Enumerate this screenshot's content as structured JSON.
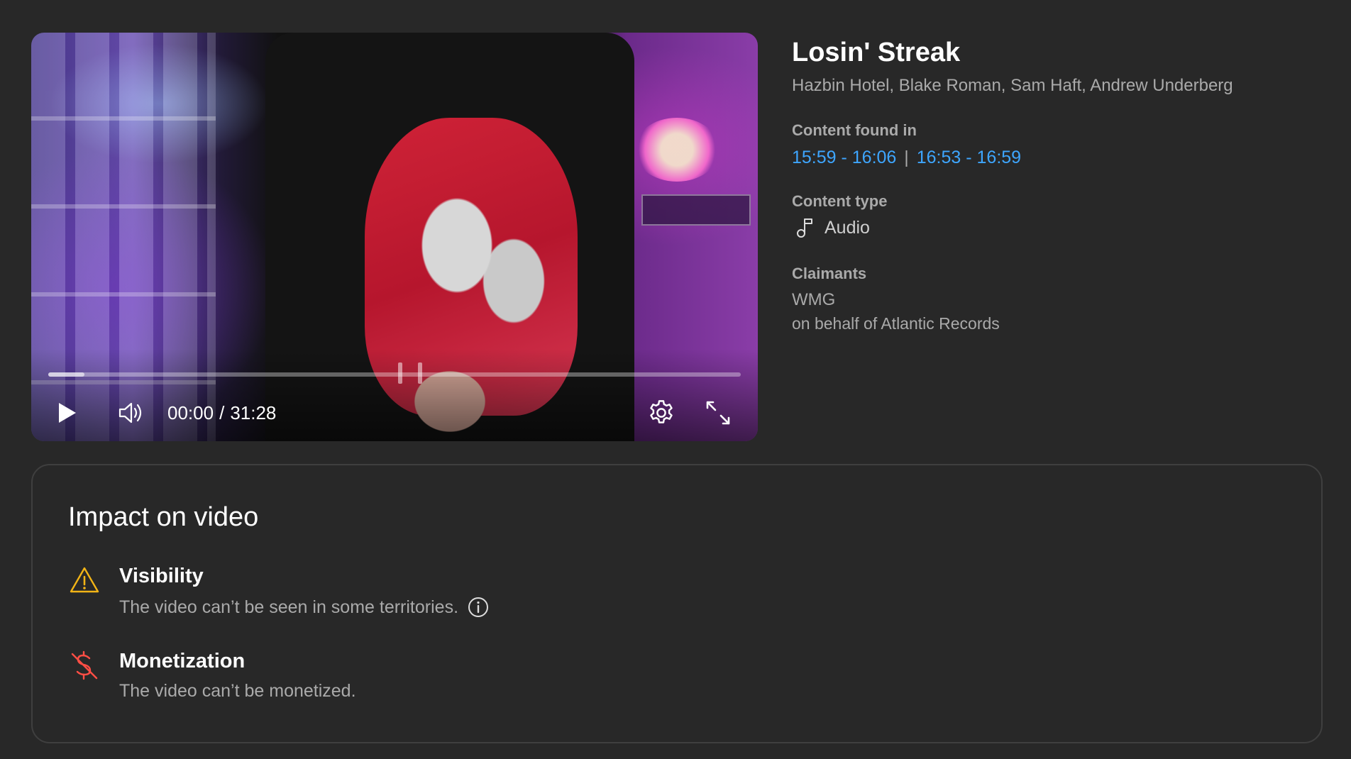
{
  "player": {
    "current_time": "00:00",
    "separator": "/",
    "duration": "31:28",
    "progress_fraction": 0.0,
    "buffered_fraction": 0.052,
    "claim_markers_fraction": [
      0.508,
      0.537
    ]
  },
  "track": {
    "title": "Losin' Streak",
    "artists": "Hazbin Hotel, Blake Roman, Sam Haft, Andrew Underberg"
  },
  "content_found": {
    "label": "Content found in",
    "ranges": [
      "15:59 - 16:06",
      "16:53 - 16:59"
    ],
    "separator": "|"
  },
  "content_type": {
    "label": "Content type",
    "value": "Audio",
    "icon": "music-note-icon"
  },
  "claimants": {
    "label": "Claimants",
    "name": "WMG",
    "on_behalf": "on behalf of Atlantic Records"
  },
  "impact": {
    "title": "Impact on video",
    "visibility": {
      "heading": "Visibility",
      "description": "The video can’t be seen in some territories.",
      "icon": "warning-icon",
      "color": "#f2b416"
    },
    "monetization": {
      "heading": "Monetization",
      "description": "The video can’t be monetized.",
      "icon": "no-money-icon",
      "color": "#ff4e45"
    }
  },
  "colors": {
    "background": "#282828",
    "link": "#3ea6ff",
    "muted_text": "#aaaaaa"
  }
}
